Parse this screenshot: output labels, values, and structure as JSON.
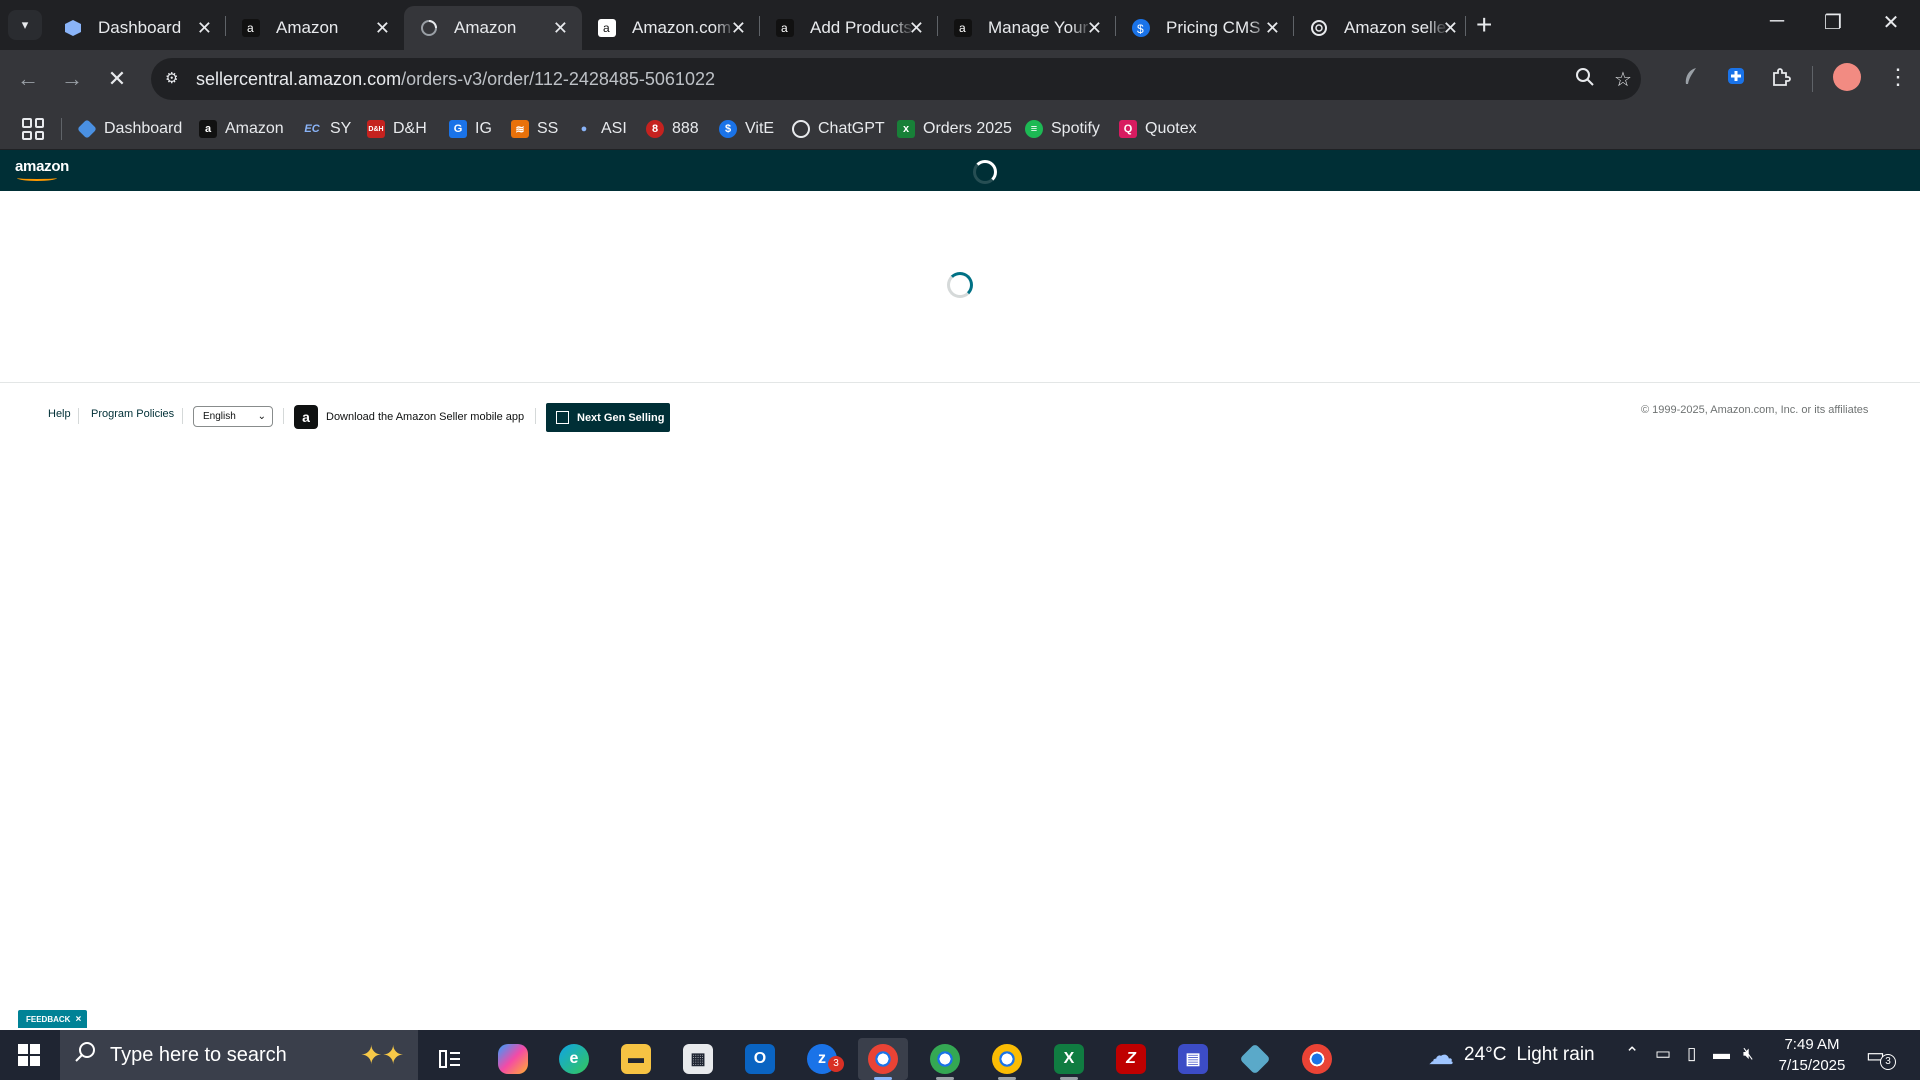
{
  "browser": {
    "tabs": [
      {
        "title": "Dashboard",
        "icon": "dashboard-favicon",
        "active": false
      },
      {
        "title": "Amazon",
        "icon": "amazon-favicon",
        "active": false
      },
      {
        "title": "Amazon",
        "icon": "loading-favicon",
        "active": true
      },
      {
        "title": "Amazon.com",
        "icon": "amazon-favicon",
        "active": false
      },
      {
        "title": "Add Products",
        "icon": "amazon-favicon",
        "active": false
      },
      {
        "title": "Manage Your",
        "icon": "amazon-favicon",
        "active": false
      },
      {
        "title": "Pricing CMS",
        "icon": "pricing-favicon",
        "active": false
      },
      {
        "title": "Amazon seller",
        "icon": "openai-favicon",
        "active": false
      }
    ],
    "url_host": "sellercentral.amazon.com",
    "url_path": "/orders-v3/order/112-2428485-5061022",
    "bookmarks": [
      {
        "label": "Dashboard",
        "color": "#4a90e2"
      },
      {
        "label": "Amazon",
        "color": "#111111"
      },
      {
        "label": "SY",
        "color": "#1a73e8"
      },
      {
        "label": "D&H",
        "color": "#c5221f"
      },
      {
        "label": "IG",
        "color": "#1a73e8"
      },
      {
        "label": "SS",
        "color": "#e8710a"
      },
      {
        "label": "ASI",
        "color": "#1a73e8"
      },
      {
        "label": "888",
        "color": "#c5221f"
      },
      {
        "label": "VitE",
        "color": "#1a73e8"
      },
      {
        "label": "ChatGPT",
        "color": "#5f6368"
      },
      {
        "label": "Orders 2025",
        "color": "#188038"
      },
      {
        "label": "Spotify",
        "color": "#1db954"
      },
      {
        "label": "Quotex",
        "color": "#d81b60"
      }
    ]
  },
  "page": {
    "logo_text": "amazon",
    "footer": {
      "help": "Help",
      "program_policies": "Program Policies",
      "language": "English",
      "app_download": "Download the Amazon Seller mobile app",
      "next_gen": "Next Gen Selling",
      "copyright": "© 1999-2025, Amazon.com, Inc. or its affiliates"
    },
    "feedback": "FEEDBACK",
    "feedback_close": "×"
  },
  "taskbar": {
    "search_placeholder": "Type here to search",
    "temperature": "24°C",
    "weather": "Light rain",
    "time": "7:49 AM",
    "date": "7/15/2025",
    "notification_count": "3",
    "outlook_badge": "3"
  },
  "colors": {
    "seller_header": "#002f36",
    "chrome_dark": "#202124",
    "chrome_toolbar": "#35363a",
    "taskbar": "#1f2532"
  }
}
